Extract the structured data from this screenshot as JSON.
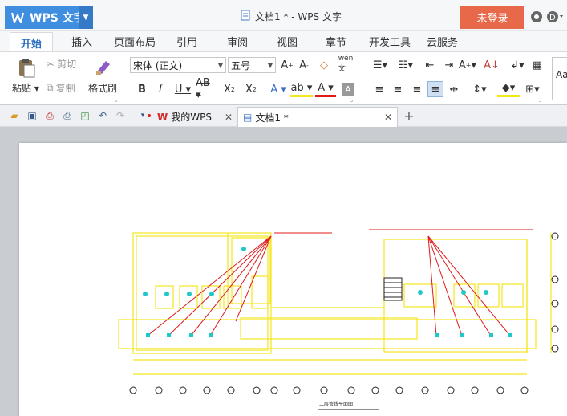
{
  "app": {
    "name": "WPS 文字",
    "window_title": "文档1 * - WPS 文字",
    "login_label": "未登录"
  },
  "tabs": [
    "开始",
    "插入",
    "页面布局",
    "引用",
    "审阅",
    "视图",
    "章节",
    "开发工具",
    "云服务"
  ],
  "ribbon": {
    "paste_label": "粘贴",
    "cut_label": "剪切",
    "copy_label": "复制",
    "format_painter_label": "格式刷",
    "font_name": "宋体 (正文)",
    "font_size": "五号",
    "styles_preview": "Aa"
  },
  "doc_tabs": [
    {
      "label": "我的WPS"
    },
    {
      "label": "文档1 *"
    }
  ],
  "drawing": {
    "caption": "二层管线平面图"
  },
  "colors": {
    "accent": "#3f8ee0",
    "login_bg": "#e8694a",
    "cad_yellow": "#f5e61e",
    "cad_red": "#e01a1a"
  }
}
